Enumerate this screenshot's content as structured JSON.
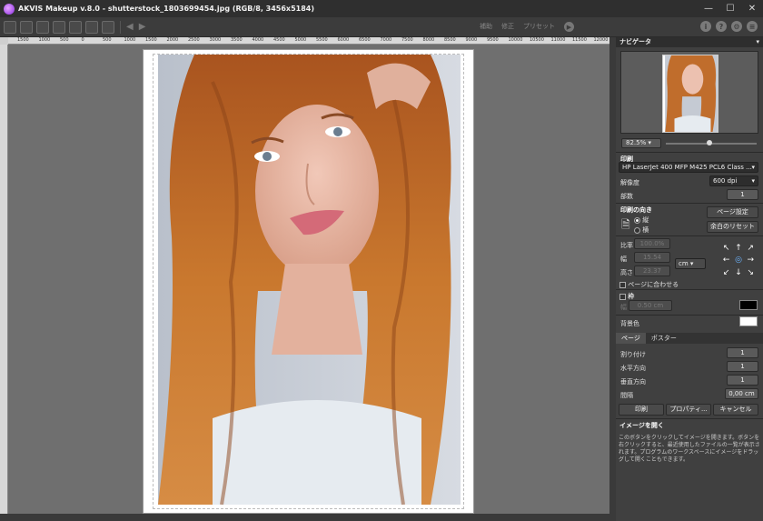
{
  "window": {
    "title": "AKVIS Makeup v.8.0 - shutterstock_1803699454.jpg (RGB/8, 3456x5184)",
    "min": "—",
    "max": "☐",
    "close": "✕"
  },
  "toolbar": {
    "mode_view": "補助",
    "mode_process": "修正",
    "mode_preset": "プリセット"
  },
  "ruler": {
    "ticks": [
      "1500",
      "1000",
      "500",
      "0",
      "500",
      "1000",
      "1500",
      "2000",
      "2500",
      "3000",
      "3500",
      "4000",
      "4500",
      "5000",
      "5500",
      "6000",
      "6500",
      "7000",
      "7500",
      "8000",
      "8500",
      "9000",
      "9500",
      "10000",
      "10500",
      "11000",
      "11500",
      "12000"
    ]
  },
  "navigator": {
    "title": "ナビゲータ",
    "zoom": "82.5%",
    "zoom_fraction": 0.48
  },
  "print": {
    "title": "印刷",
    "printer": "HP LaserJet 400 MFP M425 PCL6 Class ...",
    "resolution_label": "解像度",
    "resolution": "600 dpi",
    "copies_label": "部数",
    "copies": "1",
    "orientation_label": "印刷の向き",
    "portrait": "縦",
    "landscape": "横",
    "page_setup": "ページ設定",
    "reset_margins": "余白のリセット",
    "scale_label": "比率",
    "scale_value": "100.0%",
    "width_label": "幅",
    "width_value": "15.54",
    "height_label": "高さ",
    "height_value": "23.37",
    "unit": "cm",
    "fit_page": "ページに合わせる",
    "frame_label": "枠",
    "frame_size_prefix": "幅",
    "frame_size": "0.50 cm",
    "bg_label": "背景色",
    "frame_color": "#000000",
    "bg_color": "#ffffff"
  },
  "tabs": {
    "page": "ページ",
    "poster": "ポスター"
  },
  "page": {
    "layout_label": "割り付け",
    "layout": "1",
    "horiz_label": "水平方向",
    "horiz": "1",
    "vert_label": "垂直方向",
    "vert": "1",
    "gap_label": "間隔",
    "gap": "0,00 cm"
  },
  "actions": {
    "print": "印刷",
    "properties": "プロパティ...",
    "cancel": "キャンセル"
  },
  "open_image": {
    "title": "イメージを開く",
    "text": "このボタンをクリックしてイメージを開きます。ボタンを右クリックすると、最近使用したファイルの一覧が表示されます。プログラムのワークスペースにイメージをドラッグして開くこともできます。"
  }
}
